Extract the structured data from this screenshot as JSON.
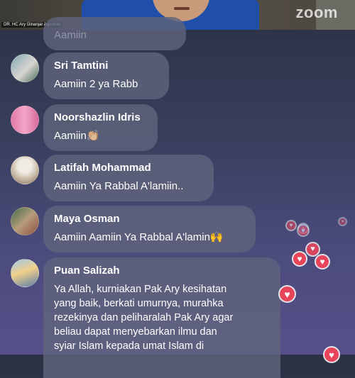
{
  "video": {
    "participant_name": "DR. HC Ary Ginanjar Agustian",
    "logo_text": "zoom"
  },
  "comments": [
    {
      "author": "",
      "text": "Aamiin"
    },
    {
      "author": "Sri Tamtini",
      "text": "Aamiin 2 ya Rabb"
    },
    {
      "author": "Noorshazlin Idris",
      "text": "Aamiin👏🏼"
    },
    {
      "author": "Latifah Mohammad",
      "text": "Aamiin Ya Rabbal A'lamiin.."
    },
    {
      "author": "Maya Osman",
      "text": "Aamiin Aamiin Ya Rabbal A'lamin🙌"
    },
    {
      "author": "Puan Salizah",
      "text": "Ya Allah, kurniakan Pak Ary kesihatan\nyang baik, berkati umurnya, murahka\nrezekinya dan peliharalah Pak Ary agar\nbeliau dapat menyebarkan ilmu dan\nsyiar Islam kepada umat Islam di"
    }
  ],
  "reactions": [
    "heart-icon"
  ],
  "colors": {
    "bubble": "#5f647d",
    "heart": "#e8445a"
  }
}
